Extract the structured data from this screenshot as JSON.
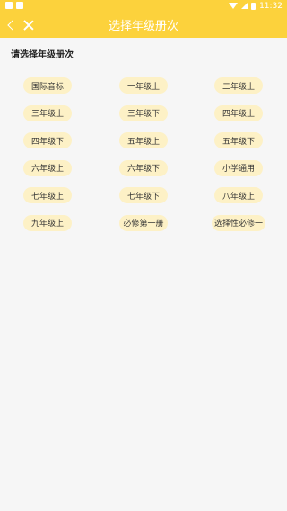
{
  "status_bar": {
    "time": "11:32"
  },
  "toolbar": {
    "title": "选择年级册次"
  },
  "section": {
    "label": "请选择年级册次"
  },
  "grades": [
    "国际音标",
    "一年级上",
    "二年级上",
    "三年级上",
    "三年级下",
    "四年级上",
    "四年级下",
    "五年级上",
    "五年级下",
    "六年级上",
    "六年级下",
    "小学通用",
    "七年级上",
    "七年级下",
    "八年级上",
    "九年级上",
    "必修第一册",
    "选择性必修一"
  ]
}
